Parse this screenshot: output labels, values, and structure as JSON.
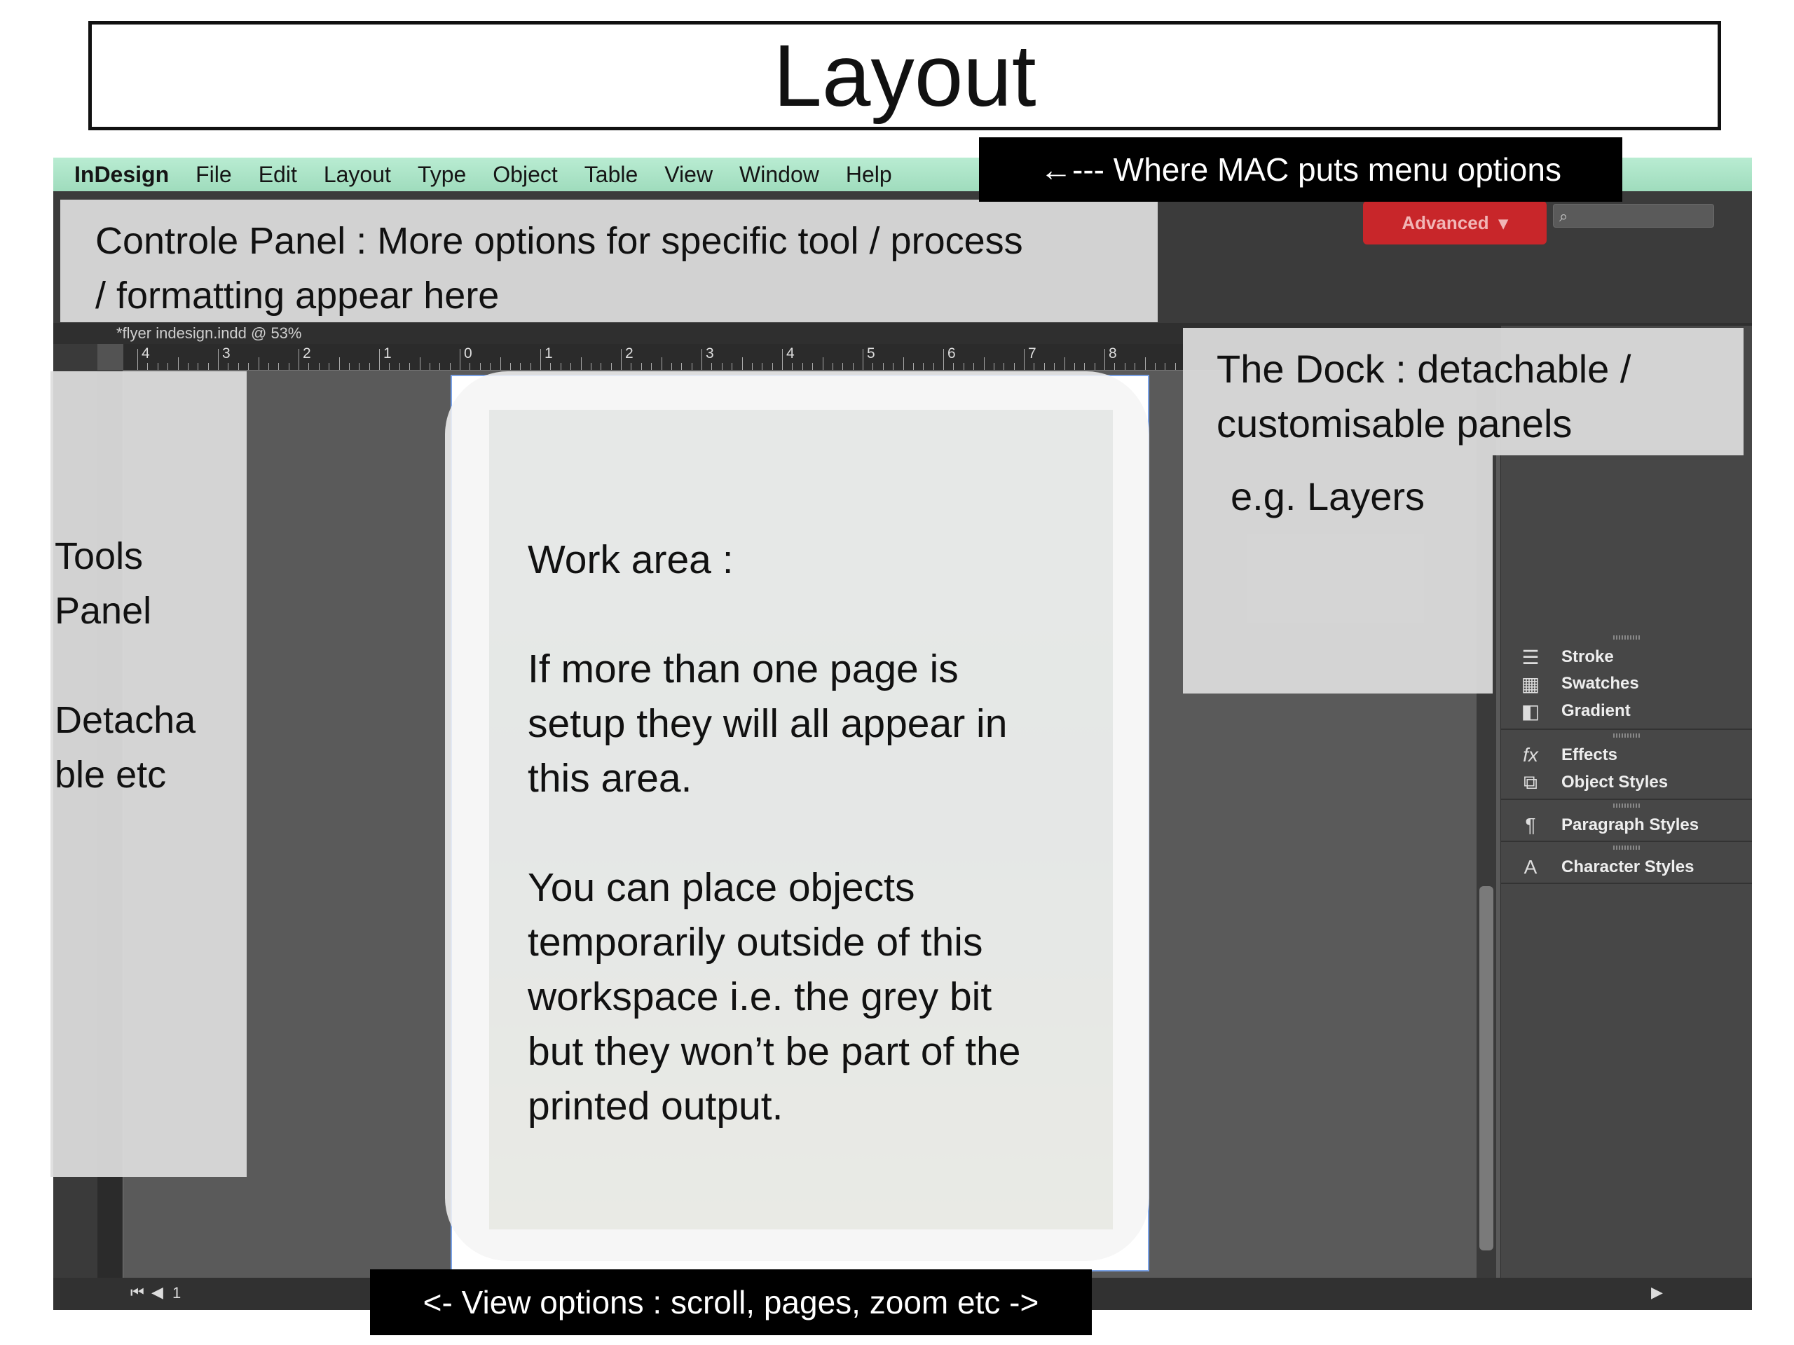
{
  "slide": {
    "title": "Layout"
  },
  "menubar": {
    "app_name": "InDesign",
    "items": [
      "File",
      "Edit",
      "Layout",
      "Type",
      "Object",
      "Table",
      "View",
      "Window",
      "Help"
    ]
  },
  "document": {
    "tab_title": "*flyer indesign.indd @ 53%"
  },
  "ruler": {
    "labels": [
      "4",
      "3",
      "2",
      "1",
      "0",
      "1",
      "2",
      "3",
      "4",
      "5",
      "6",
      "7",
      "8"
    ]
  },
  "toolbar": {
    "workspace_label": "Advanced"
  },
  "dock": {
    "items": [
      {
        "label": "Stroke",
        "icon": "stroke-icon"
      },
      {
        "label": "Swatches",
        "icon": "swatches-icon"
      },
      {
        "label": "Gradient",
        "icon": "gradient-icon"
      },
      {
        "label": "Effects",
        "icon": "effects-icon"
      },
      {
        "label": "Object Styles",
        "icon": "object-styles-icon"
      },
      {
        "label": "Paragraph Styles",
        "icon": "paragraph-styles-icon"
      },
      {
        "label": "Character Styles",
        "icon": "character-styles-icon"
      }
    ]
  },
  "status": {
    "page_number": "1"
  },
  "annotations": {
    "menu": "←--- Where MAC puts menu options",
    "control": "Controle Panel : More options for specific tool / process\n/ formatting appear here",
    "tools": "Tools\nPanel\n\nDetacha\nble etc",
    "dock": "The Dock : detachable /\ncustomisable panels",
    "dock_example": "e.g. Layers",
    "work_area": "Work area :\n\nIf more than one page is\nsetup they will all appear in\nthis area.\n\nYou can place objects\ntemporarily outside of this\nworkspace i.e. the grey bit\nbut they won’t be part of the\nprinted output.",
    "view": "<- View options : scroll, pages, zoom etc  ->"
  },
  "colors": {
    "menubar": "#a9e2c5",
    "advanced_button": "#c8262a",
    "app_bg": "#535353",
    "page_frame": "#7aa2e6"
  }
}
